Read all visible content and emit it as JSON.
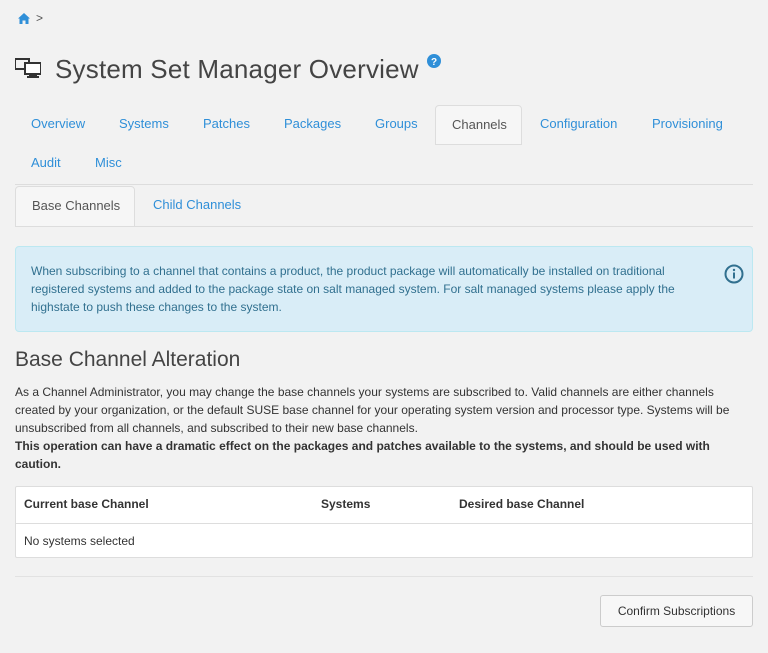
{
  "breadcrumb": {
    "separator": ">",
    "home_icon": "home-icon"
  },
  "page": {
    "title": "System Set Manager Overview",
    "title_icon": "desktop-icon",
    "help_icon": "help-icon"
  },
  "main_tabs": [
    {
      "label": "Overview"
    },
    {
      "label": "Systems"
    },
    {
      "label": "Patches"
    },
    {
      "label": "Packages"
    },
    {
      "label": "Groups"
    },
    {
      "label": "Channels",
      "active": true
    },
    {
      "label": "Configuration"
    },
    {
      "label": "Provisioning"
    },
    {
      "label": "Audit"
    },
    {
      "label": "Misc"
    }
  ],
  "sub_tabs": [
    {
      "label": "Base Channels",
      "active": true
    },
    {
      "label": "Child Channels"
    }
  ],
  "alert": {
    "text": "When subscribing to a channel that contains a product, the product package will automatically be installed on traditional registered systems and added to the package state on salt managed system. For salt managed systems please apply the highstate to push these changes to the system.",
    "icon": "info-icon",
    "color": "#31708f",
    "background": "#d9edf7"
  },
  "section": {
    "title": "Base Channel Alteration",
    "description": "As a Channel Administrator, you may change the base channels your systems are subscribed to. Valid channels are either channels created by your organization, or the default SUSE base channel for your operating system version and processor type. Systems will be unsubscribed from all channels, and subscribed to their new base channels.",
    "warning": "This operation can have a dramatic effect on the packages and patches available to the systems, and should be used with caution."
  },
  "table": {
    "columns": [
      "Current base Channel",
      "Systems",
      "Desired base Channel"
    ],
    "empty_message": "No systems selected"
  },
  "actions": {
    "confirm_label": "Confirm Subscriptions"
  },
  "colors": {
    "link": "#2f8fd8",
    "background": "#f2f2f2"
  }
}
